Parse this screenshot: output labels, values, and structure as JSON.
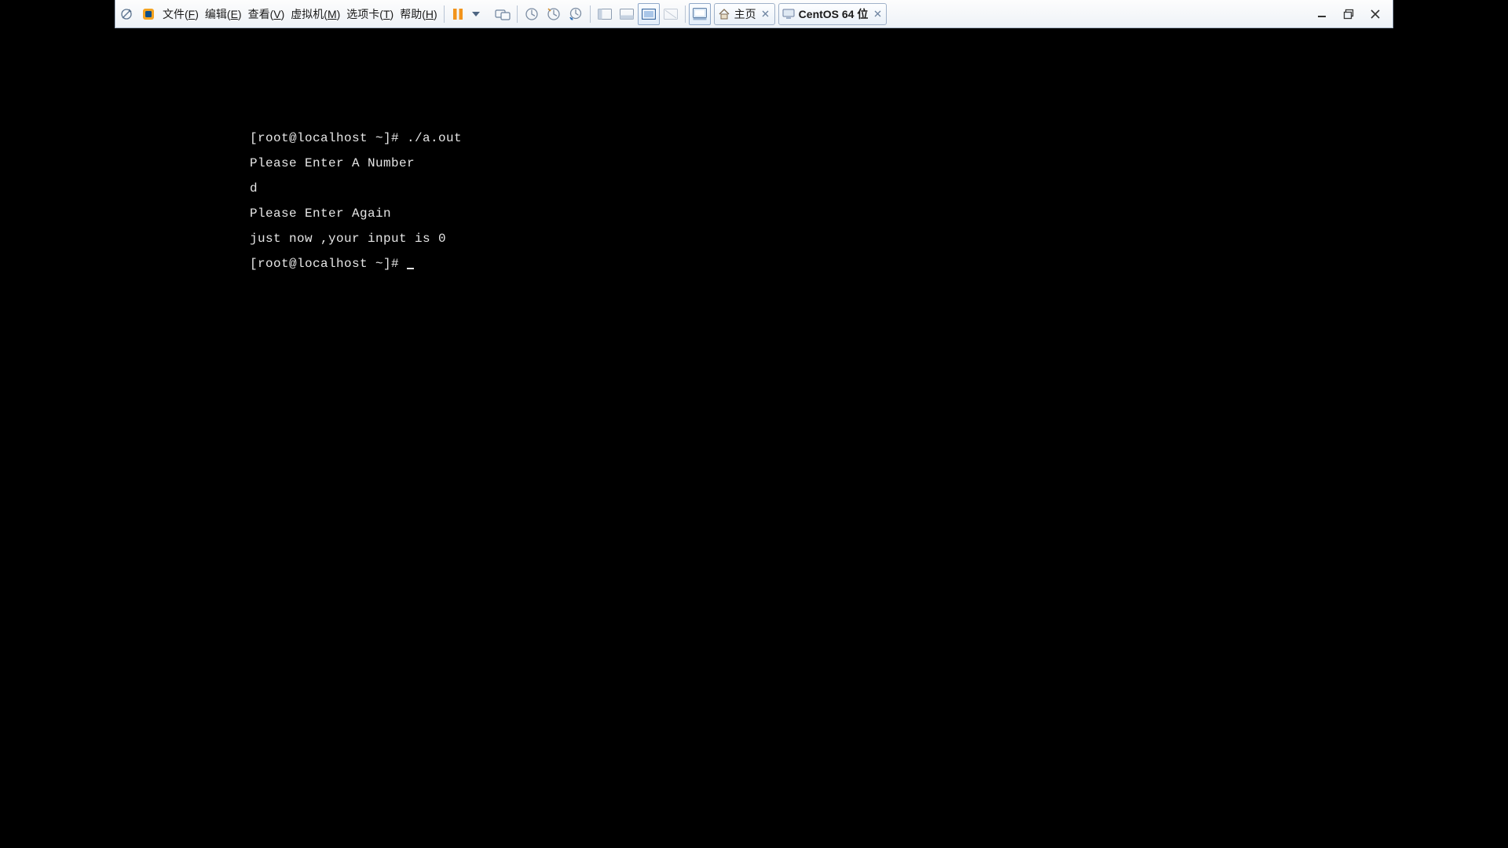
{
  "menus": {
    "file": {
      "base": "文件(",
      "hot": "F",
      "tail": ")"
    },
    "edit": {
      "base": "编辑(",
      "hot": "E",
      "tail": ")"
    },
    "view": {
      "base": "查看(",
      "hot": "V",
      "tail": ")"
    },
    "vm": {
      "base": "虚拟机(",
      "hot": "M",
      "tail": ")"
    },
    "tabs": {
      "base": "选项卡(",
      "hot": "T",
      "tail": ")"
    },
    "help": {
      "base": "帮助(",
      "hot": "H",
      "tail": ")"
    }
  },
  "tabs": {
    "home": "主页",
    "guest": "CentOS 64 位"
  },
  "terminal": {
    "l1": "[root@localhost ~]# ./a.out",
    "l2": "Please Enter A Number",
    "l3": "d",
    "l4": "Please Enter Again",
    "l5": "just now ,your input is 0",
    "l6": "[root@localhost ~]# "
  }
}
